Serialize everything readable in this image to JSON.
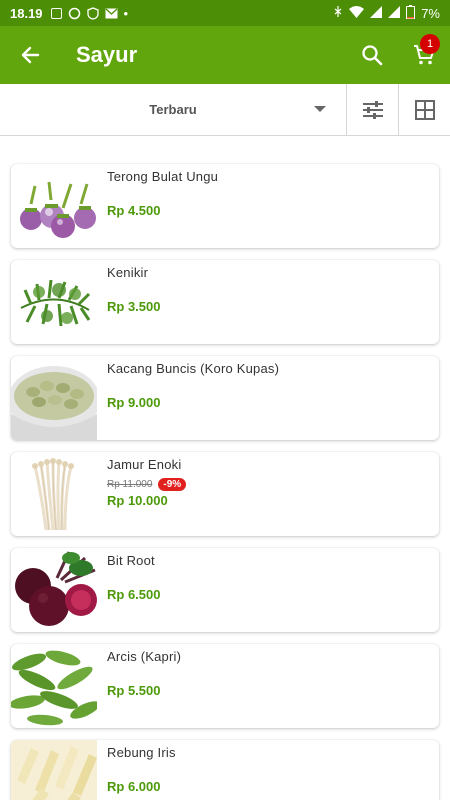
{
  "status_bar": {
    "time": "18.19",
    "battery": "7%"
  },
  "app_bar": {
    "title": "Sayur",
    "cart_count": "1"
  },
  "filter": {
    "sort_selected": "Terbaru"
  },
  "products": [
    {
      "name": "Terong Bulat Ungu",
      "price": "Rp 4.500"
    },
    {
      "name": "Kenikir",
      "price": "Rp 3.500"
    },
    {
      "name": "Kacang Buncis (Koro Kupas)",
      "price": "Rp 9.000"
    },
    {
      "name": "Jamur Enoki",
      "old_price": "Rp 11.000",
      "discount": "-9%",
      "price": "Rp 10.000"
    },
    {
      "name": "Bit Root",
      "price": "Rp 6.500"
    },
    {
      "name": "Arcis (Kapri)",
      "price": "Rp 5.500"
    },
    {
      "name": "Rebung Iris",
      "price": "Rp 6.000"
    }
  ],
  "colors": {
    "status_bar": "#4c8f06",
    "app_bar": "#62a60d",
    "price": "#4c9a0a",
    "badge": "#d50000",
    "discount": "#e0211d"
  }
}
